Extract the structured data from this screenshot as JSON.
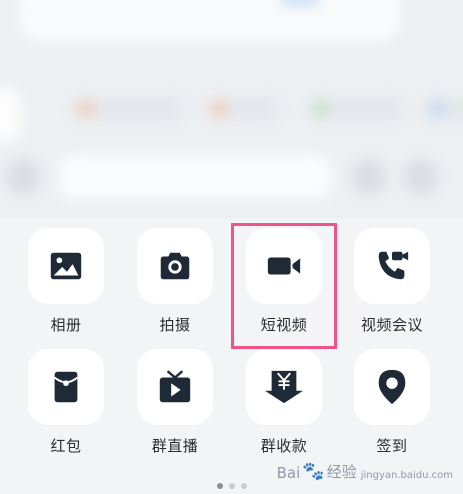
{
  "apps": [
    {
      "label": "相册",
      "icon": "image-icon"
    },
    {
      "label": "拍摄",
      "icon": "camera-icon"
    },
    {
      "label": "短视频",
      "icon": "video-camera-icon"
    },
    {
      "label": "视频会议",
      "icon": "video-call-icon"
    },
    {
      "label": "红包",
      "icon": "red-envelope-icon"
    },
    {
      "label": "群直播",
      "icon": "tv-live-icon"
    },
    {
      "label": "群收款",
      "icon": "yuan-receive-icon"
    },
    {
      "label": "签到",
      "icon": "location-pin-icon"
    }
  ],
  "pager": {
    "pages": 3,
    "active": 1
  },
  "watermark": {
    "brand": "Bai",
    "brand2": "经验",
    "sub": "jingyan.baidu.com"
  },
  "colors": {
    "icon": "#1f2a36",
    "highlight": "#f0528a",
    "tile": "#ffffff"
  }
}
